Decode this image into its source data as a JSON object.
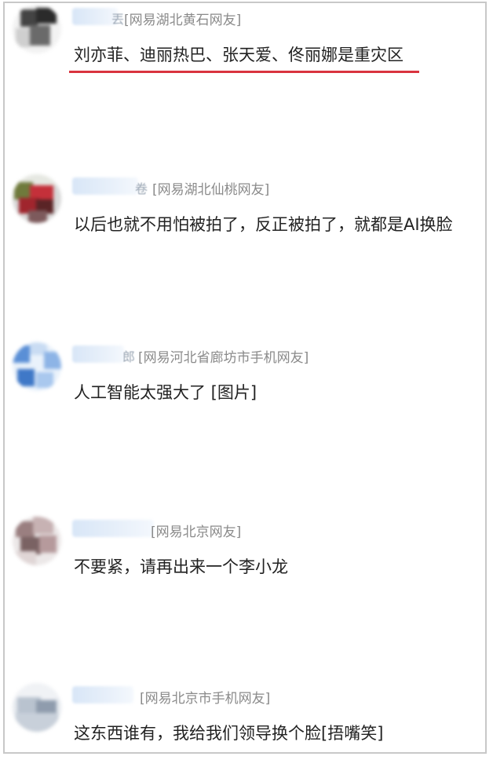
{
  "comments": [
    {
      "meta": "[网易湖北黄石网友]",
      "name_tail": "丟",
      "text": "刘亦菲、迪丽热巴、张天爱、佟丽娜是重灾区"
    },
    {
      "meta": "[网易湖北仙桃网友]",
      "name_tail": "卷",
      "text": "以后也就不用怕被拍了，反正被拍了，就都是AI换脸"
    },
    {
      "meta": "[网易河北省廊坊市手机网友]",
      "name_tail": "郎",
      "text": "人工智能太强大了 [图片]"
    },
    {
      "meta": "[网易北京网友]",
      "name_tail": "",
      "text": "不要紧，请再出来一个李小龙"
    },
    {
      "meta": "[网易北京市手机网友]",
      "name_tail": "",
      "text": "这东西谁有，我给我们领导换个脸[捂嘴笑]"
    }
  ],
  "colors": {
    "highlight": "#d9333f",
    "meta": "#8a8a8a",
    "text": "#222222"
  }
}
